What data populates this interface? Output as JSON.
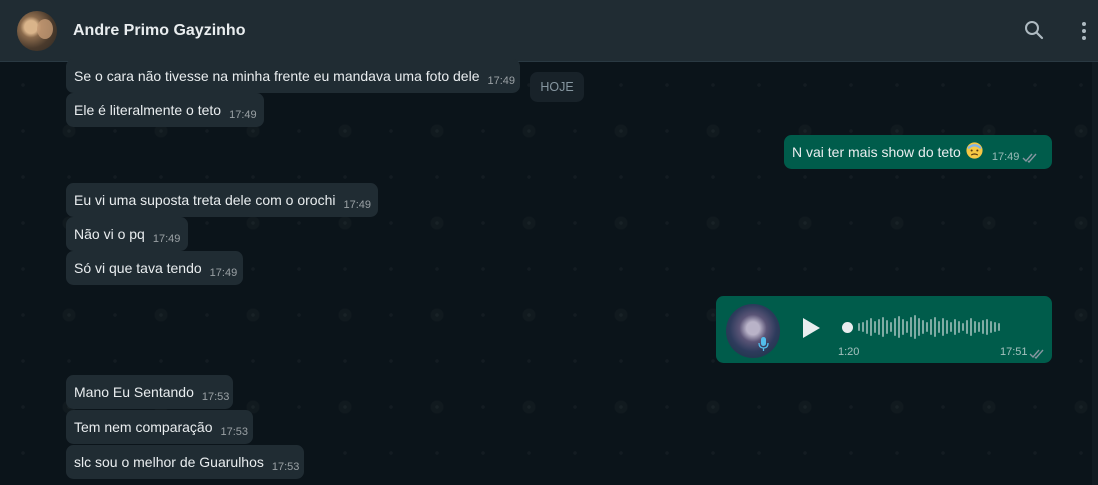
{
  "header": {
    "contact_name": "Andre Primo Gayzinho",
    "icons": [
      "search-icon",
      "menu-icon"
    ]
  },
  "date_divider": "HOJE",
  "messages": [
    {
      "text": "Se o cara não tivesse na minha frente eu mandava uma foto dele",
      "time": "17:49"
    },
    {
      "text": "Ele é literalmente o teto",
      "time": "17:49"
    },
    {
      "text": "N vai ter mais show do teto",
      "time": "17:49",
      "emoji": "face-emoji"
    },
    {
      "text": "Eu vi uma suposta treta dele com o orochi",
      "time": "17:49"
    },
    {
      "text": "Não vi o pq",
      "time": "17:49"
    },
    {
      "text": "Só vi que tava tendo",
      "time": "17:49"
    },
    {
      "text": "Mano Eu Sentando",
      "time": "17:53"
    },
    {
      "text": "Tem nem comparação",
      "time": "17:53"
    },
    {
      "text": "slc sou o melhor de Guarulhos",
      "time": "17:53"
    }
  ],
  "voice_message": {
    "duration": "1:20",
    "time": "17:51",
    "progress": 0
  },
  "colors": {
    "background": "#0b141a",
    "header": "#202c33",
    "incoming_bubble": "#202c33",
    "outgoing_bubble": "#005c4b",
    "read_ticks": "#8696a0"
  }
}
